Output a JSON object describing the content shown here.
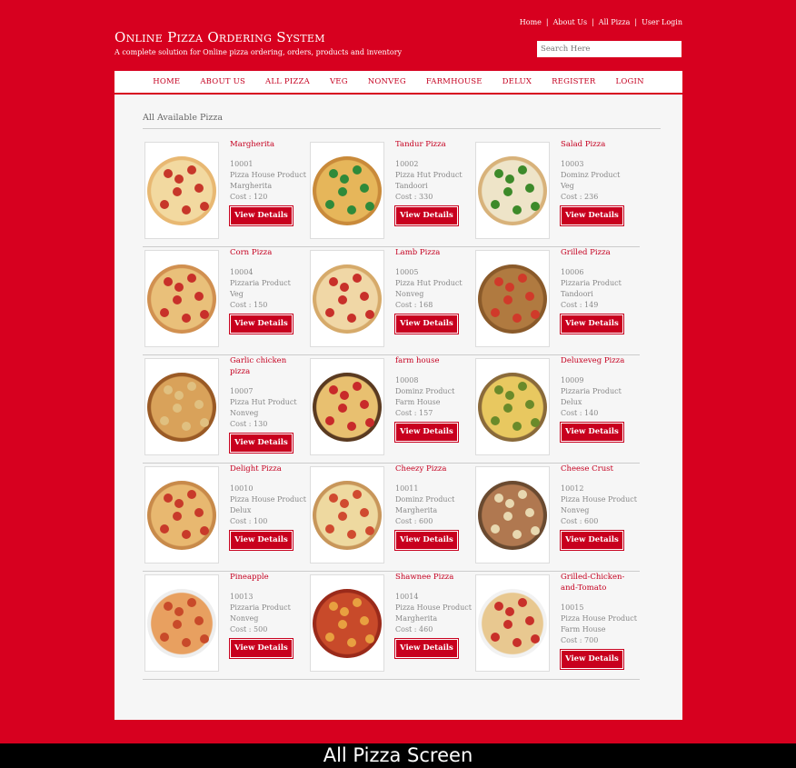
{
  "toplinks": [
    "Home",
    "About Us",
    "All Pizza",
    "User Login"
  ],
  "site": {
    "title": "Online Pizza Ordering System",
    "subtitle": "A complete solution for Online pizza ordering, orders, products and inventory"
  },
  "search": {
    "placeholder": "Search Here"
  },
  "nav": [
    "HOME",
    "ABOUT US",
    "ALL PIZZA",
    "VEG",
    "NONVEG",
    "FARMHOUSE",
    "DELUX",
    "REGISTER",
    "LOGIN"
  ],
  "heading": "All Available Pizza",
  "button_label": "View Details",
  "products": [
    {
      "name": "Margherita",
      "id": "10001",
      "brand": "Pizza House Product",
      "category": "Margherita",
      "cost": "Cost : 120",
      "crust": "#e8b872",
      "base": "#f2d9a0",
      "top": "#c7372a"
    },
    {
      "name": "Tandur Pizza",
      "id": "10002",
      "brand": "Pizza Hut Product",
      "category": "Tandoori",
      "cost": "Cost : 330",
      "crust": "#c98a3a",
      "base": "#e6b65a",
      "top": "#2f8a3a"
    },
    {
      "name": "Salad Pizza",
      "id": "10003",
      "brand": "Dominz Product",
      "category": "Veg",
      "cost": "Cost : 236",
      "crust": "#d8b27a",
      "base": "#eee4c8",
      "top": "#3d8a2a"
    },
    {
      "name": "Corn Pizza",
      "id": "10004",
      "brand": "Pizzaria Product",
      "category": "Veg",
      "cost": "Cost : 150",
      "crust": "#d19050",
      "base": "#e9c07a",
      "top": "#c8302a"
    },
    {
      "name": "Lamb Pizza",
      "id": "10005",
      "brand": "Pizza Hut Product",
      "category": "Nonveg",
      "cost": "Cost : 168",
      "crust": "#d6aa6a",
      "base": "#f0d7a6",
      "top": "#c8302a"
    },
    {
      "name": "Grilled Pizza",
      "id": "10006",
      "brand": "Pizzaria Product",
      "category": "Tandoori",
      "cost": "Cost : 149",
      "crust": "#8a5a2a",
      "base": "#b07a40",
      "top": "#d03a2a"
    },
    {
      "name": "Garlic chicken pizza",
      "id": "10007",
      "brand": "Pizza Hut Product",
      "category": "Nonveg",
      "cost": "Cost : 130",
      "crust": "#9a5a25",
      "base": "#d9a25a",
      "top": "#e0c080"
    },
    {
      "name": "farm house",
      "id": "10008",
      "brand": "Dominz Product",
      "category": "Farm House",
      "cost": "Cost : 157",
      "crust": "#5a3a20",
      "base": "#e8c070",
      "top": "#c82a2a"
    },
    {
      "name": "Deluxeveg Pizza",
      "id": "10009",
      "brand": "Pizzaria Product",
      "category": "Delux",
      "cost": "Cost : 140",
      "crust": "#8a6a3a",
      "base": "#e8c860",
      "top": "#6a8a2a"
    },
    {
      "name": "Delight Pizza",
      "id": "10010",
      "brand": "Pizza House Product",
      "category": "Delux",
      "cost": "Cost : 100",
      "crust": "#c88a4a",
      "base": "#e8b870",
      "top": "#c83a2a"
    },
    {
      "name": "Cheezy Pizza",
      "id": "10011",
      "brand": "Dominz Product",
      "category": "Margherita",
      "cost": "Cost : 600",
      "crust": "#c8965a",
      "base": "#eed9a0",
      "top": "#d04a30"
    },
    {
      "name": "Cheese Crust",
      "id": "10012",
      "brand": "Pizza House Product",
      "category": "Nonveg",
      "cost": "Cost : 600",
      "crust": "#6a4a30",
      "base": "#b07850",
      "top": "#e8d8b0"
    },
    {
      "name": "Pineapple",
      "id": "10013",
      "brand": "Pizzaria Product",
      "category": "Nonveg",
      "cost": "Cost : 500",
      "crust": "#eeeeee",
      "base": "#e8a060",
      "top": "#c84a2a"
    },
    {
      "name": "Shawnee Pizza",
      "id": "10014",
      "brand": "Pizza House Product",
      "category": "Margherita",
      "cost": "Cost : 460",
      "crust": "#9a2a1a",
      "base": "#c84a2a",
      "top": "#e8a040"
    },
    {
      "name": "Grilled-Chicken-and-Tomato",
      "id": "10015",
      "brand": "Pizza House Product",
      "category": "Farm House",
      "cost": "Cost : 700",
      "crust": "#f2f2f2",
      "base": "#e8c890",
      "top": "#c8302a"
    }
  ],
  "caption": "All Pizza Screen"
}
